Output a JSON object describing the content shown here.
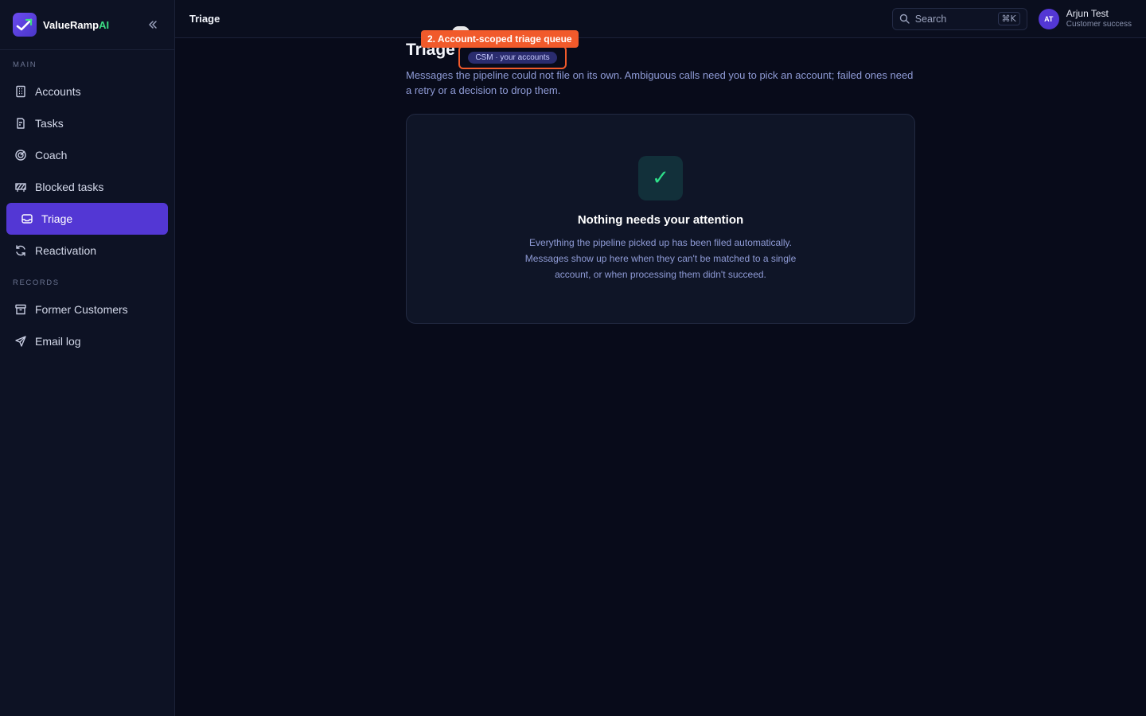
{
  "brand": {
    "name": "ValueRamp",
    "suffix": "AI",
    "accent": "#3ddc84"
  },
  "sidebar": {
    "sections": [
      {
        "label": "MAIN",
        "items": [
          {
            "label": "Accounts",
            "icon": "building-icon"
          },
          {
            "label": "Tasks",
            "icon": "clipboard-icon"
          },
          {
            "label": "Coach",
            "icon": "target-icon"
          },
          {
            "label": "Blocked tasks",
            "icon": "blocked-icon"
          },
          {
            "label": "Triage",
            "icon": "inbox-icon",
            "active": true
          },
          {
            "label": "Reactivation",
            "icon": "refresh-icon"
          }
        ]
      },
      {
        "label": "RECORDS",
        "items": [
          {
            "label": "Former Customers",
            "icon": "archive-icon"
          },
          {
            "label": "Email log",
            "icon": "send-icon"
          }
        ]
      }
    ],
    "active_color": "#5337d4"
  },
  "topbar": {
    "title": "Triage",
    "search": {
      "placeholder": "Search",
      "shortcut": "⌘K"
    },
    "user": {
      "initials": "AT",
      "name": "Arjun Test",
      "role": "Customer success"
    }
  },
  "main": {
    "title": "Triage",
    "badge": "CSM · your accounts",
    "tooltip": "2. Account-scoped triage queue",
    "subtitle": "Messages the pipeline could not file on its own. Ambiguous calls need you to pick an account; failed ones need a retry or a decision to drop them.",
    "empty_state": {
      "icon": "✓",
      "title": "Nothing needs your attention",
      "text": "Everything the pipeline picked up has been filed automatically. Messages show up here when they can't be matched to a single account, or when processing them didn't succeed."
    }
  }
}
